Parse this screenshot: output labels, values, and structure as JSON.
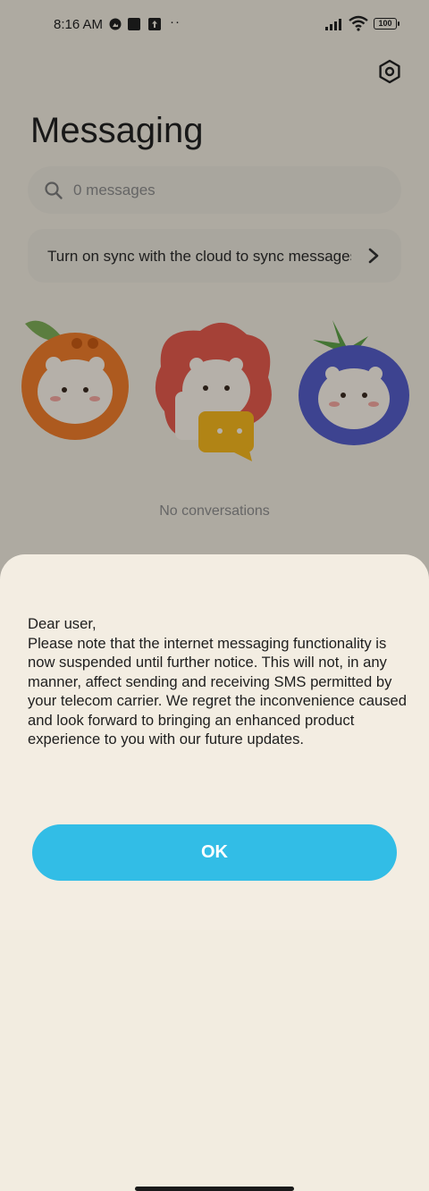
{
  "status_bar": {
    "time": "8:16 AM",
    "icons": [
      "photo-icon",
      "square-icon",
      "upload-icon"
    ],
    "more": "··",
    "battery_level": "100"
  },
  "header": {
    "title": "Messaging",
    "settings_icon": "settings-hex-icon"
  },
  "search": {
    "placeholder": "0 messages",
    "icon": "search-icon"
  },
  "sync_banner": {
    "text": "Turn on sync with the cloud to sync messages",
    "icon": "chevron-right-icon"
  },
  "empty_state": {
    "illustration": "three-bear-fruit-mascots",
    "text": "No conversations"
  },
  "dialog": {
    "lines": [
      "Dear user,",
      "Please note that the internet messaging functionality is now suspended until further notice. This will not, in any manner, affect sending and receiving SMS permitted by your telecom carrier. We regret the inconvenience caused and look forward to bringing an enhanced product experience to you with our future updates."
    ],
    "ok_label": "OK"
  },
  "colors": {
    "accent": "#32bde6",
    "background": "#f2ece0",
    "overlay": "rgba(0,0,0,0.28)"
  }
}
